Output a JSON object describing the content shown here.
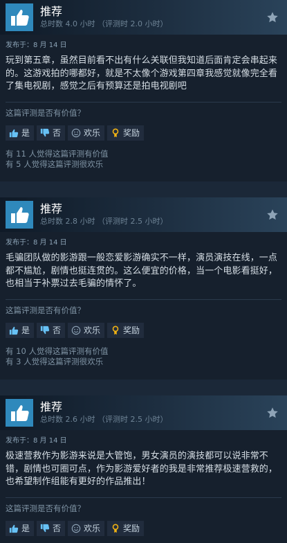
{
  "reviews": [
    {
      "title": "推荐",
      "playtime": "总时数 4.0 小时 （评测时 2.0 小时）",
      "posted": "发布于：8 月 14 日",
      "body": "玩到第五章，虽然目前看不出有什么关联但我知道后面肯定会串起来的。这游戏拍的哪都好，就是不太像个游戏第四章我感觉就像完全看了集电视剧，感觉之后有预算还是拍电视剧吧",
      "question": "这篇评测是否有价值？",
      "yes": "是",
      "no": "否",
      "funny": "欢乐",
      "award": "奖励",
      "helpful": "有 11 人觉得这篇评测有价值",
      "funny_count": "有 5 人觉得这篇评测很欢乐"
    },
    {
      "title": "推荐",
      "playtime": "总时数 2.8 小时 （评测时 2.5 小时）",
      "posted": "发布于：8 月 14 日",
      "body": "毛骗团队做的影游跟一般恋爱影游确实不一样，演员演技在线，一点都不尴尬，剧情也挺连贯的。这么便宜的价格，当一个电影看挺好，也相当于补票过去毛骗的情怀了。",
      "question": "这篇评测是否有价值？",
      "yes": "是",
      "no": "否",
      "funny": "欢乐",
      "award": "奖励",
      "helpful": "有 10 人觉得这篇评测有价值",
      "funny_count": "有 3 人觉得这篇评测很欢乐"
    },
    {
      "title": "推荐",
      "playtime": "总时数 2.6 小时 （评测时 2.5 小时）",
      "posted": "发布于：8 月 14 日",
      "body": "极速营救作为影游来说是大管饱，男女演员的演技都可以说非常不错，剧情也可圈可点，作为影游爱好者的我是非常推荐极速营救的，也希望制作组能有更好的作品推出！",
      "question": "这篇评测是否有价值？",
      "yes": "是",
      "no": "否",
      "funny": "欢乐",
      "award": "奖励"
    }
  ],
  "colors": {
    "page_bg": "#1b2838",
    "card_bg": "#16202d",
    "thumb_bg": "#2f89bc",
    "award_icon": "#f2b313"
  },
  "icons": {
    "recommend": "thumbs-up-icon",
    "star": "star-icon",
    "yes": "thumbs-up-icon",
    "no": "thumbs-down-icon",
    "funny": "smiley-icon",
    "award": "award-icon"
  }
}
